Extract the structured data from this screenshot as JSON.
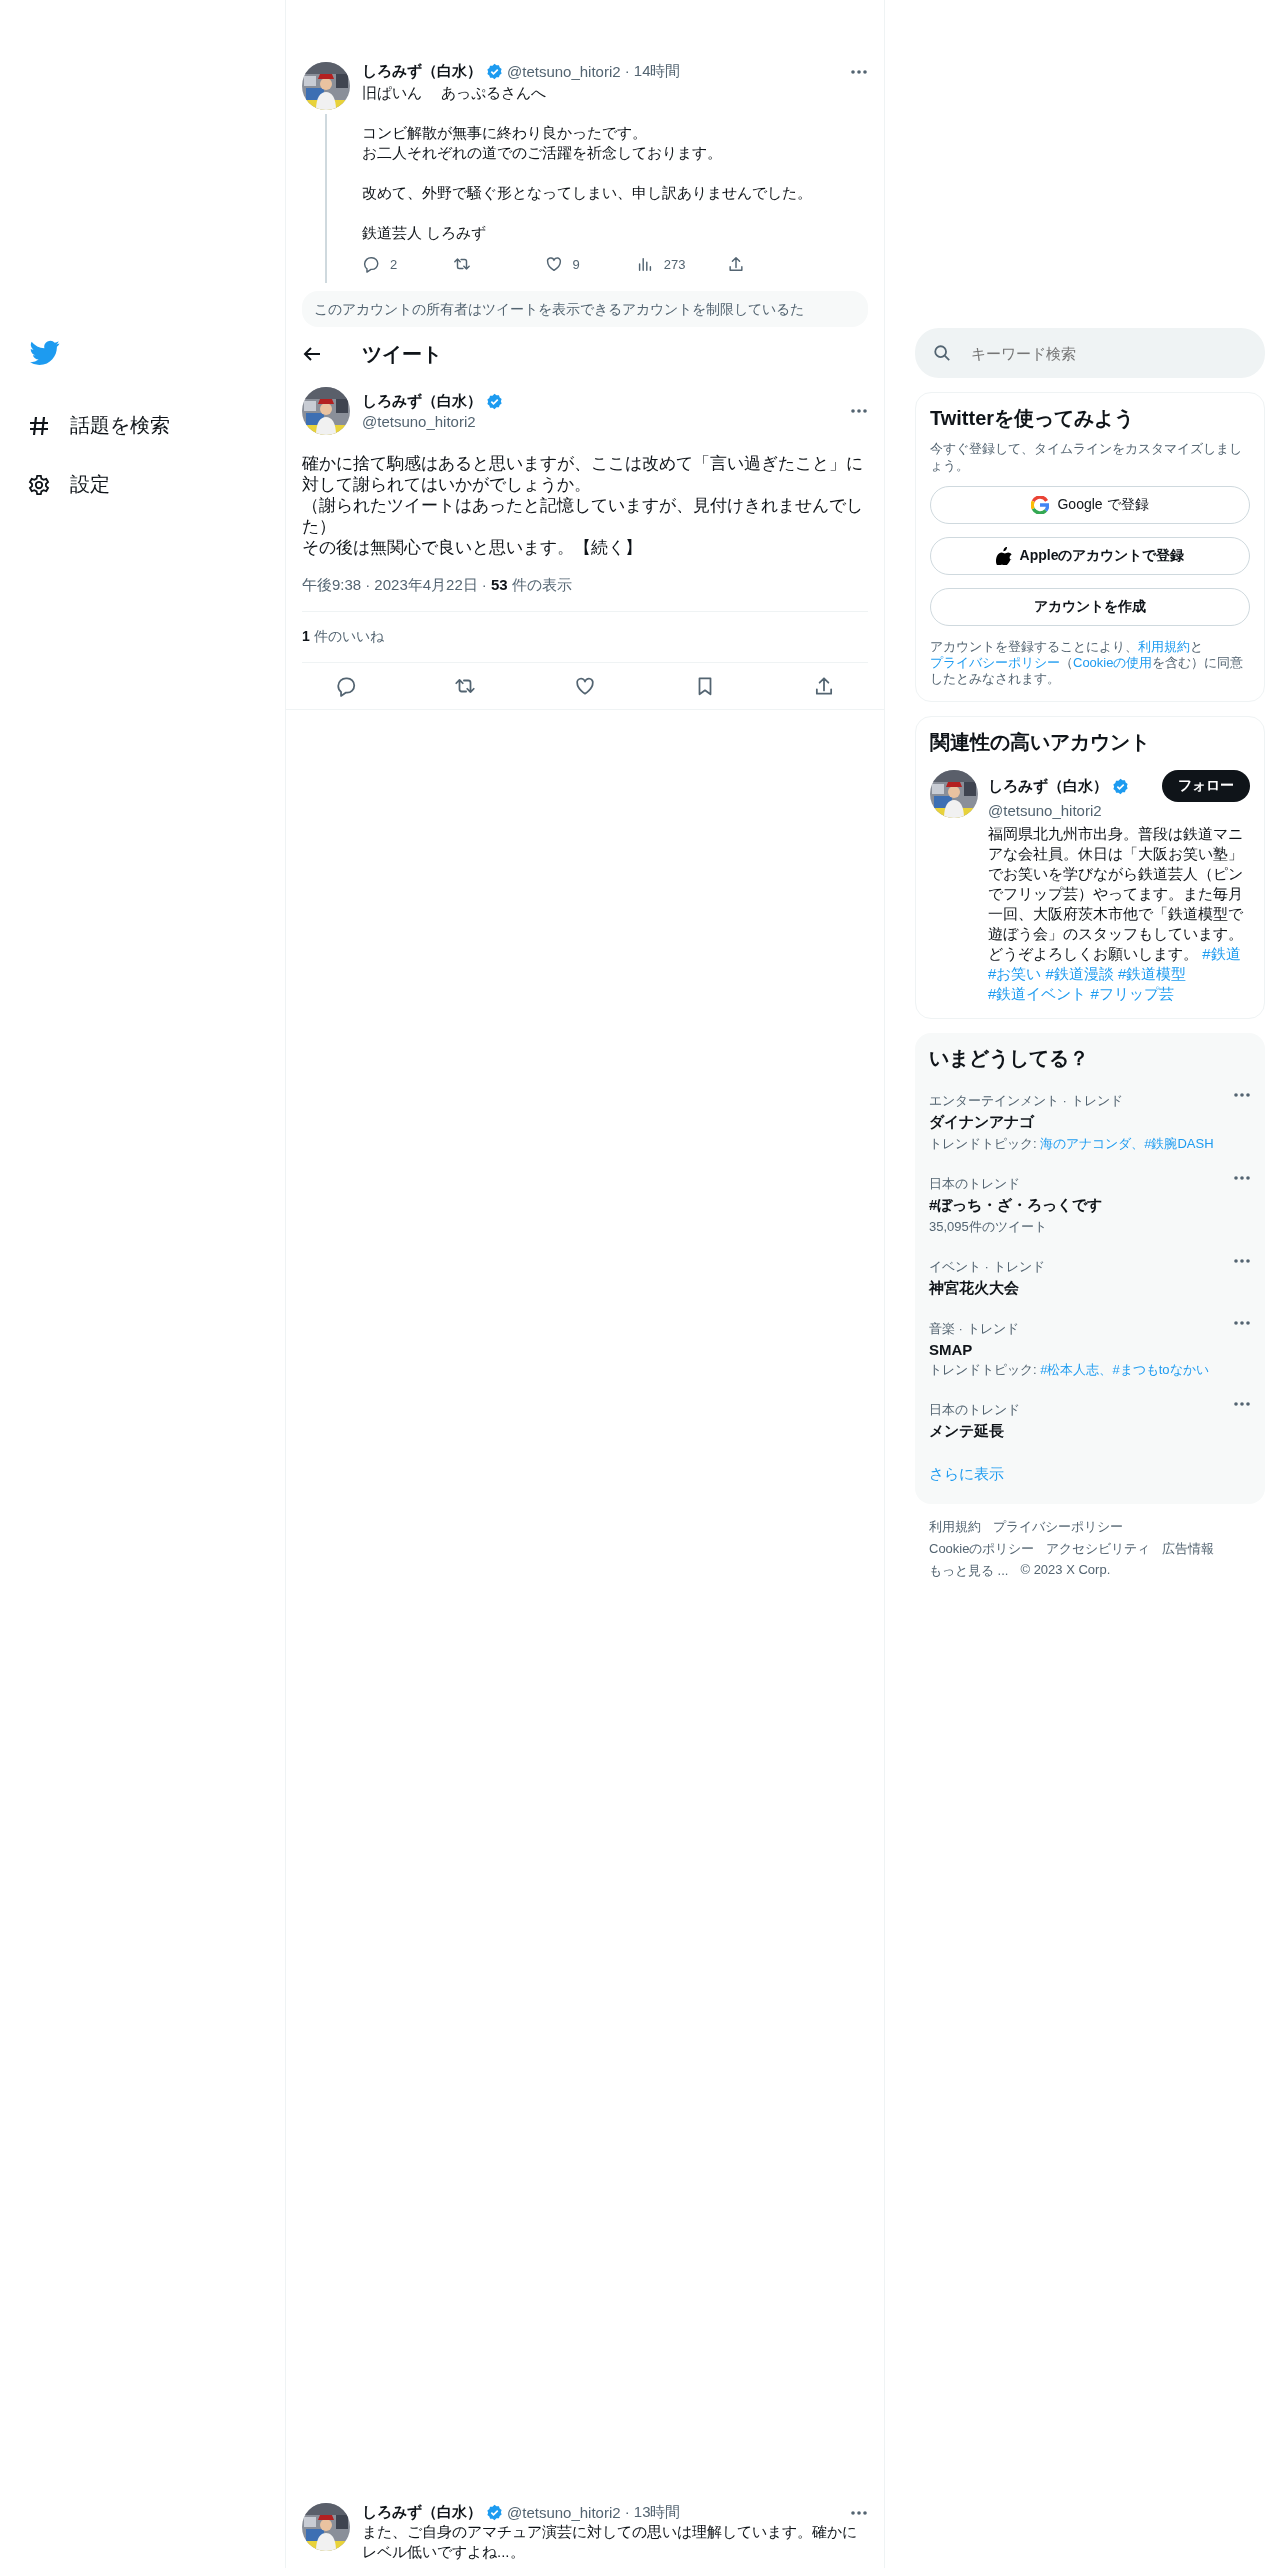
{
  "sidebar": {
    "items": [
      {
        "kind": "logo"
      },
      {
        "kind": "explore",
        "label": "話題を検索"
      },
      {
        "kind": "settings",
        "label": "設定"
      }
    ]
  },
  "thread_tweet": {
    "name": "しろみず（白水）",
    "handle": "@tetsuno_hitori2",
    "time": "· 14時間",
    "paragraphs": [
      [
        "旧ぱいん　 あっぷるさんへ"
      ],
      [
        "コンビ解散が無事に終わり良かったです。",
        "お二人それぞれの道でのご活躍を祈念しております。"
      ],
      [
        "改めて、外野で騒ぐ形となってしまい、申し訳ありませんでした。"
      ],
      [
        "鉄道芸人 しろみず"
      ]
    ],
    "actions": [
      {
        "kind": "reply",
        "count": "2"
      },
      {
        "kind": "retweet"
      },
      {
        "kind": "like",
        "count": "9"
      },
      {
        "kind": "views",
        "count": "273"
      },
      {
        "kind": "share"
      }
    ]
  },
  "restricted_notice": "このアカウントの所有者はツイートを表示できるアカウントを制限しているた",
  "header": {
    "title": "ツイート"
  },
  "main_tweet": {
    "name": "しろみず（白水）",
    "handle": "@tetsuno_hitori2",
    "lines": [
      "確かに捨て駒感はあると思いますが、ここは改めて「言い過ぎたこと」に対して謝られてはいかがでしょうか。",
      "（謝られたツイートはあったと記憶していますが、見付けきれませんでした）",
      "その後は無関心で良いと思います。【続く】"
    ],
    "time": "午後9:38",
    "date": "· 2023年4月22日",
    "views_sep": "·",
    "views_count": "53",
    "views_label": "件の表示",
    "likes_count": "1",
    "likes_label": "件のいいね",
    "actions": [
      {
        "kind": "reply"
      },
      {
        "kind": "retweet"
      },
      {
        "kind": "like"
      },
      {
        "kind": "bookmark"
      },
      {
        "kind": "share"
      }
    ]
  },
  "bottom_tweet": {
    "name": "しろみず（白水）",
    "handle": "@tetsuno_hitori2",
    "time": "· 13時間",
    "text": "また、ご自身のアマチュア演芸に対しての思いは理解しています。確かにレベル低いですよね...。"
  },
  "search": {
    "placeholder": "キーワード検索"
  },
  "signup": {
    "title": "Twitterを使ってみよう",
    "subtitle": "今すぐ登録して、タイムラインをカスタマイズしましょう。",
    "buttons": [
      {
        "kind": "google",
        "label": "Google で登録"
      },
      {
        "kind": "apple",
        "label": "Appleのアカウントで登録"
      },
      {
        "kind": "create",
        "label": "アカウントを作成"
      }
    ],
    "legal": [
      {
        "text": "アカウントを登録することにより、",
        "link": false
      },
      {
        "text": "利用規約",
        "link": true
      },
      {
        "text": "と",
        "link": false
      },
      {
        "text": "プライバシーポリシー",
        "link": true
      },
      {
        "text": "（",
        "link": false
      },
      {
        "text": "Cookieの使用",
        "link": true
      },
      {
        "text": "を含む）に同意したとみなされます。",
        "link": false
      }
    ]
  },
  "related": {
    "title": "関連性の高いアカウント",
    "account": {
      "name": "しろみず（白水）",
      "handle": "@tetsuno_hitori2",
      "follow": "フォロー",
      "bio": "福岡県北九州市出身。普段は鉄道マニアな会社員。休日は「大阪お笑い塾」でお笑いを学びながら鉄道芸人（ピンでフリップ芸）やってます。また毎月一回、大阪府茨木市他で「鉄道模型で遊ぼう会」のスタッフもしています。どうぞよろしくお願いします。",
      "hashtags": [
        "#鉄道",
        "#お笑い",
        "#鉄道漫談",
        "#鉄道模型",
        "#鉄道イベント",
        "#フリップ芸"
      ]
    }
  },
  "trends": {
    "title": "いまどうしてる？",
    "items": [
      {
        "context": "エンターテインメント · トレンド",
        "name": "ダイナンアナゴ",
        "topics_label": "トレンドトピック: ",
        "topics": "海のアナコンダ、#鉄腕DASH"
      },
      {
        "context": "日本のトレンド",
        "name": "#ぼっち・ざ・ろっくです",
        "count": "35,095件のツイート"
      },
      {
        "context": "イベント · トレンド",
        "name": "神宮花火大会"
      },
      {
        "context": "音楽 · トレンド",
        "name": "SMAP",
        "topics_label": "トレンドトピック: ",
        "topics": "#松本人志、#まつもtoなかい"
      },
      {
        "context": "日本のトレンド",
        "name": "メンテ延長"
      }
    ],
    "more": "さらに表示"
  },
  "footer": [
    [
      "利用規約",
      "プライバシーポリシー"
    ],
    [
      "Cookieのポリシー",
      "アクセシビリティ",
      "広告情報"
    ],
    [
      "もっと見る ...",
      "© 2023 X Corp."
    ]
  ]
}
